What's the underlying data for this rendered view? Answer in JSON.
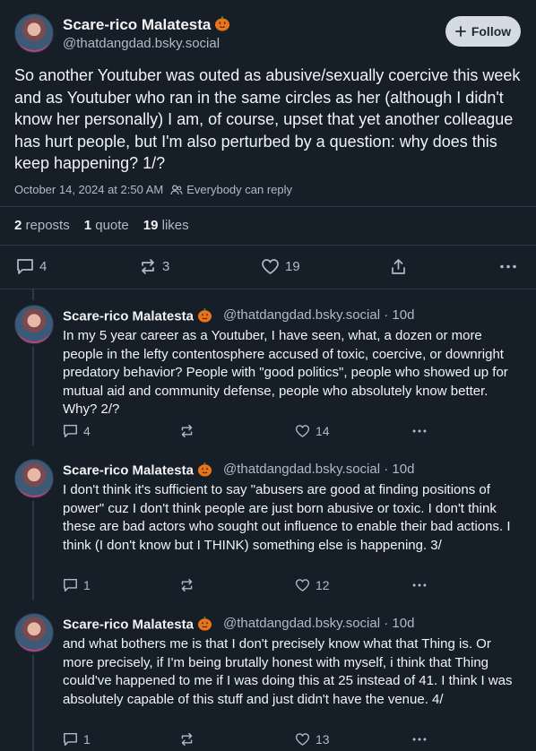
{
  "post": {
    "author_name": "Scare-rico Malatesta",
    "author_handle": "@thatdangdad.bsky.social",
    "follow_label": "Follow",
    "text": "So another Youtuber was outed as abusive/sexually coercive this week and as Youtuber who ran in the same circles as her (although I didn't know her personally) I am, of course, upset that yet another colleague has hurt people, but I'm also perturbed by a question: why does this keep happening? 1/?",
    "timestamp": "October 14, 2024 at 2:50 AM",
    "reply_setting": "Everybody can reply",
    "reposts_count": "2",
    "reposts_label": "reposts",
    "quotes_count": "1",
    "quotes_label": "quote",
    "likes_count": "19",
    "likes_label": "likes",
    "actions": {
      "replies": "4",
      "reposts": "3",
      "likes": "19"
    }
  },
  "replies": [
    {
      "author_name": "Scare-rico Malatesta",
      "author_handle": "@thatdangdad.bsky.social",
      "age": "· 10d",
      "text": "In my 5 year career as a Youtuber, I have seen, what, a dozen or more people in the lefty contentosphere accused of toxic, coercive, or downright predatory behavior? People with \"good politics\", people who showed up for mutual aid and community defense, people who absolutely know better. Why? 2/?",
      "replies": "4",
      "reposts": "",
      "likes": "14"
    },
    {
      "author_name": "Scare-rico Malatesta",
      "author_handle": "@thatdangdad.bsky.social",
      "age": "· 10d",
      "text": "I don't think it's sufficient to say \"abusers are good at finding positions of power\" cuz I don't think people are just born abusive or toxic. I don't think these are bad actors who sought out influence to enable their bad actions. I think (I don't know but I THINK) something else is happening. 3/",
      "replies": "1",
      "reposts": "",
      "likes": "12"
    },
    {
      "author_name": "Scare-rico Malatesta",
      "author_handle": "@thatdangdad.bsky.social",
      "age": "· 10d",
      "text": "and what bothers me is that I don't precisely know what that Thing is. Or more precisely, if I'm being brutally honest with myself, i think that Thing could've happened to me if I was doing this at 25 instead of 41. I think I was absolutely capable of this stuff and just didn't have the venue. 4/",
      "replies": "1",
      "reposts": "",
      "likes": "13"
    }
  ],
  "icons": {
    "pumpkin": "pumpkin-emoji-icon",
    "follow": "plus-icon",
    "reply_setting": "people-icon",
    "reply": "speech-bubble-icon",
    "repost": "repost-arrows-icon",
    "like": "heart-icon",
    "share": "share-icon",
    "more": "ellipsis-icon"
  },
  "colors": {
    "background": "#161e27",
    "text_primary": "#f1f3f5",
    "text_secondary": "#aebbc9",
    "follow_button_bg": "#d4dbe2",
    "pumpkin": "#e8751a"
  }
}
